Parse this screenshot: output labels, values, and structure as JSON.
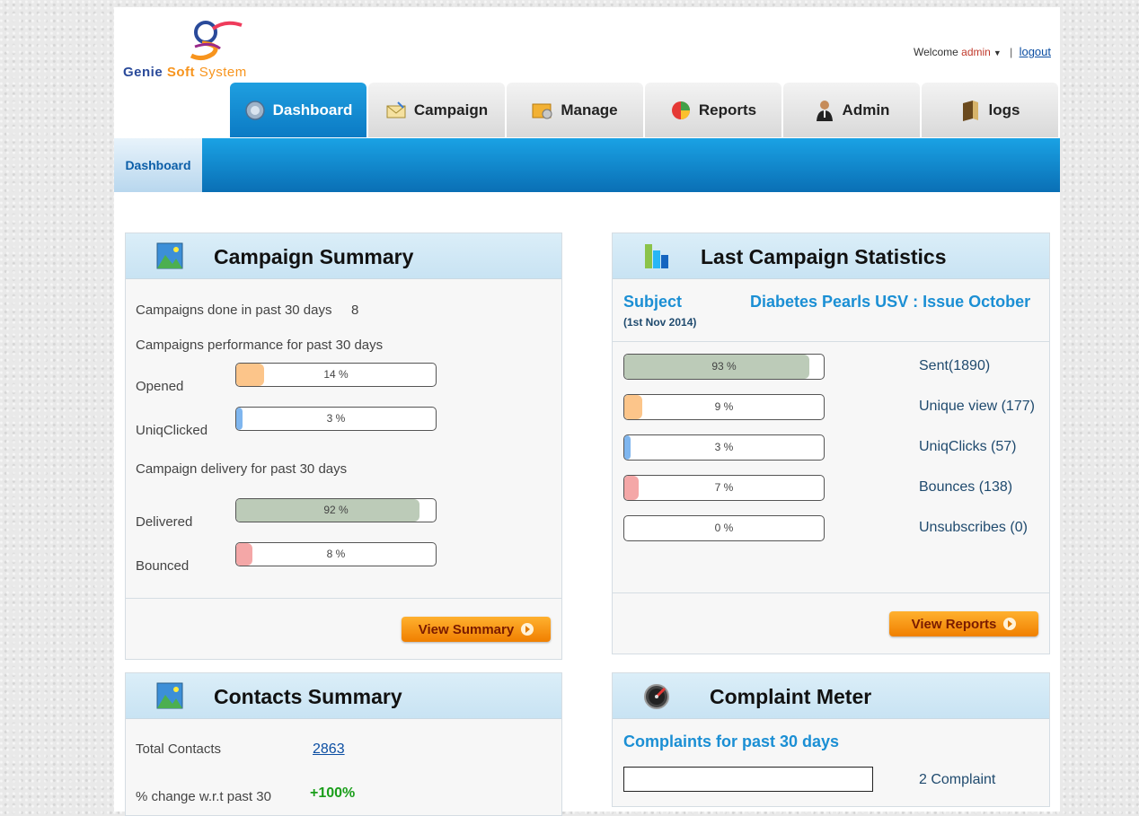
{
  "header": {
    "logo_mark": "gs",
    "logo_genie": "Genie",
    "logo_soft": "Soft",
    "logo_system": "System",
    "welcome_text": "Welcome",
    "user": "admin",
    "separator": "|",
    "logout_label": "logout"
  },
  "tabs": [
    {
      "label": "Dashboard",
      "icon": "dashboard-icon",
      "active": true
    },
    {
      "label": "Campaign",
      "icon": "envelope-icon"
    },
    {
      "label": "Manage",
      "icon": "folder-icon"
    },
    {
      "label": "Reports",
      "icon": "pie-chart-icon"
    },
    {
      "label": "Admin",
      "icon": "user-icon"
    },
    {
      "label": "logs",
      "icon": "book-icon"
    }
  ],
  "subnav": {
    "active": "Dashboard"
  },
  "campaign_summary": {
    "title": "Campaign Summary",
    "done_label": "Campaigns done in past 30 days",
    "done_value": "8",
    "performance_label": "Campaigns performance for past 30 days",
    "opened": {
      "label": "Opened",
      "pct_text": "14 %",
      "pct": 14,
      "color": "#fcc58a"
    },
    "uniq_clicked": {
      "label": "UniqClicked",
      "pct_text": "3 %",
      "pct": 3,
      "color": "#7fb6ef"
    },
    "delivery_label": "Campaign delivery for past 30 days",
    "delivered": {
      "label": "Delivered",
      "pct_text": "92 %",
      "pct": 92,
      "color": "#bccbb8"
    },
    "bounced": {
      "label": "Bounced",
      "pct_text": "8 %",
      "pct": 8,
      "color": "#f4a7a7"
    },
    "button": "View Summary"
  },
  "last_campaign": {
    "title": "Last Campaign Statistics",
    "subject_label": "Subject",
    "subject_date": "(1st Nov 2014)",
    "subject_value": "Diabetes Pearls USV : Issue October",
    "stats": [
      {
        "pct_text": "93 %",
        "pct": 93,
        "color": "#bccbb8",
        "label": "Sent(1890)"
      },
      {
        "pct_text": "9 %",
        "pct": 9,
        "color": "#fcc58a",
        "label": "Unique view (177)"
      },
      {
        "pct_text": "3 %",
        "pct": 3,
        "color": "#7fb6ef",
        "label": "UniqClicks (57)"
      },
      {
        "pct_text": "7 %",
        "pct": 7,
        "color": "#f4a7a7",
        "label": "Bounces (138)"
      },
      {
        "pct_text": "0 %",
        "pct": 0,
        "color": "#ffffff",
        "label": "Unsubscribes (0)"
      }
    ],
    "button": "View Reports"
  },
  "contacts_summary": {
    "title": "Contacts Summary",
    "total_label": "Total Contacts",
    "total_value": "2863",
    "change_label": "% change w.r.t past 30",
    "change_value": "+100%"
  },
  "complaint_meter": {
    "title": "Complaint Meter",
    "subtitle": "Complaints for past 30 days",
    "value_text": "2 Complaint"
  }
}
